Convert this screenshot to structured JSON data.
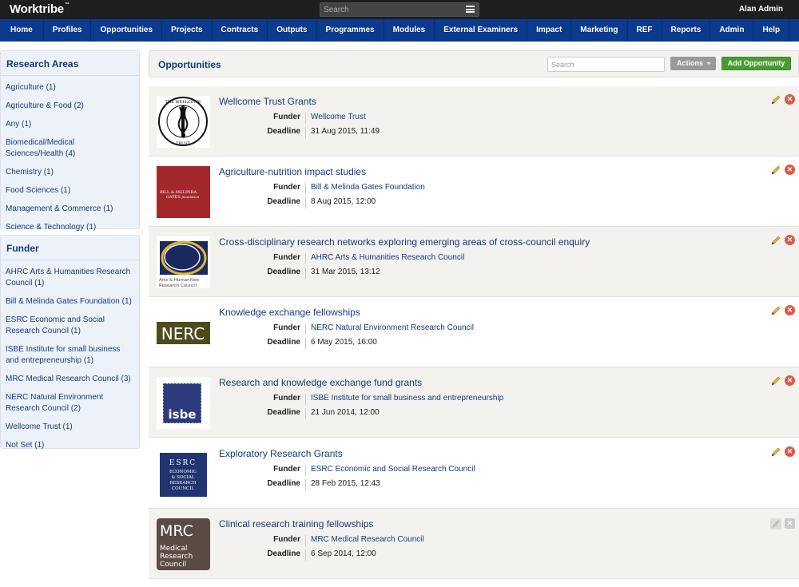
{
  "app": {
    "brand": "Worktribe",
    "brand_mark": "™",
    "user": "Alan Admin"
  },
  "top_search": {
    "placeholder": "Search"
  },
  "nav": [
    "Home",
    "Profiles",
    "Opportunities",
    "Projects",
    "Contracts",
    "Outputs",
    "Programmes",
    "Modules",
    "External Examiners",
    "Impact",
    "Marketing",
    "REF",
    "Reports",
    "Admin",
    "Help"
  ],
  "sidebar": {
    "research_areas": {
      "title": "Research Areas",
      "items": [
        "Agriculture (1)",
        "Agriculture & Food (2)",
        "Any (1)",
        "Biomedical/Medical Sciences/Health (4)",
        "Chemistry (1)",
        "Food Sciences (1)",
        "Management & Commerce (1)",
        "Science & Technology (1)"
      ]
    },
    "funder": {
      "title": "Funder",
      "items": [
        "AHRC Arts & Humanities Research Council (1)",
        "Bill & Melinda Gates Foundation (1)",
        "ESRC Economic and Social Research Council (1)",
        "ISBE Institute for small business and entrepreneurship (1)",
        "MRC Medical Research Council (3)",
        "NERC Natural Environment Research Council (2)",
        "Wellcome Trust (1)",
        "Not Set (1)"
      ]
    }
  },
  "main": {
    "title": "Opportunities",
    "search_placeholder": "Search",
    "actions_label": "Actions",
    "add_label": "Add Opportunity",
    "labels": {
      "funder": "Funder",
      "deadline": "Deadline"
    },
    "opportunities": [
      {
        "title": "Wellcome Trust Grants",
        "funder": "Wellcome Trust",
        "deadline": "31 Aug 2015, 11:49",
        "logo": "wellcome-trust-logo",
        "logo_text": "THE WELLCOME TRUST"
      },
      {
        "title": "Agriculture-nutrition impact studies",
        "funder": "Bill & Melinda Gates Foundation",
        "deadline": "8 Aug 2015, 12:00",
        "logo": "gates-foundation-logo",
        "logo_text": "BILL & MELINDA GATES foundation"
      },
      {
        "title": "Cross-disciplinary research networks exploring emerging areas of cross-council enquiry",
        "funder": "AHRC Arts & Humanities Research Council",
        "deadline": "31 Mar 2015, 13:12",
        "logo": "ahrc-logo",
        "logo_text": "Arts & Humanities Research Council"
      },
      {
        "title": "Knowledge exchange fellowships",
        "funder": "NERC Natural Environment Research Council",
        "deadline": "6 May 2015, 16:00",
        "logo": "nerc-logo",
        "logo_text": "NERC"
      },
      {
        "title": "Research and knowledge exchange fund grants",
        "funder": "ISBE Institute for small business and entrepreneurship",
        "deadline": "21 Jun 2014, 12:00",
        "logo": "isbe-logo",
        "logo_text": "isbe"
      },
      {
        "title": "Exploratory Research Grants",
        "funder": "ESRC Economic and Social Research Council",
        "deadline": "28 Feb 2015, 12:43",
        "logo": "esrc-logo",
        "logo_text": "E·S·R·C ECONOMIC & SOCIAL RESEARCH COUNCIL"
      },
      {
        "title": "Clinical research training fellowships",
        "funder": "MRC Medical Research Council",
        "deadline": "6 Sep 2014, 12:00",
        "logo": "mrc-logo",
        "logo_text": "MRC Medical Research Council"
      }
    ]
  },
  "colors": {
    "nav_bg": "#0b3a8e",
    "link": "#143b7e",
    "add_button": "#4a9a34",
    "delete_icon": "#d9594a"
  }
}
